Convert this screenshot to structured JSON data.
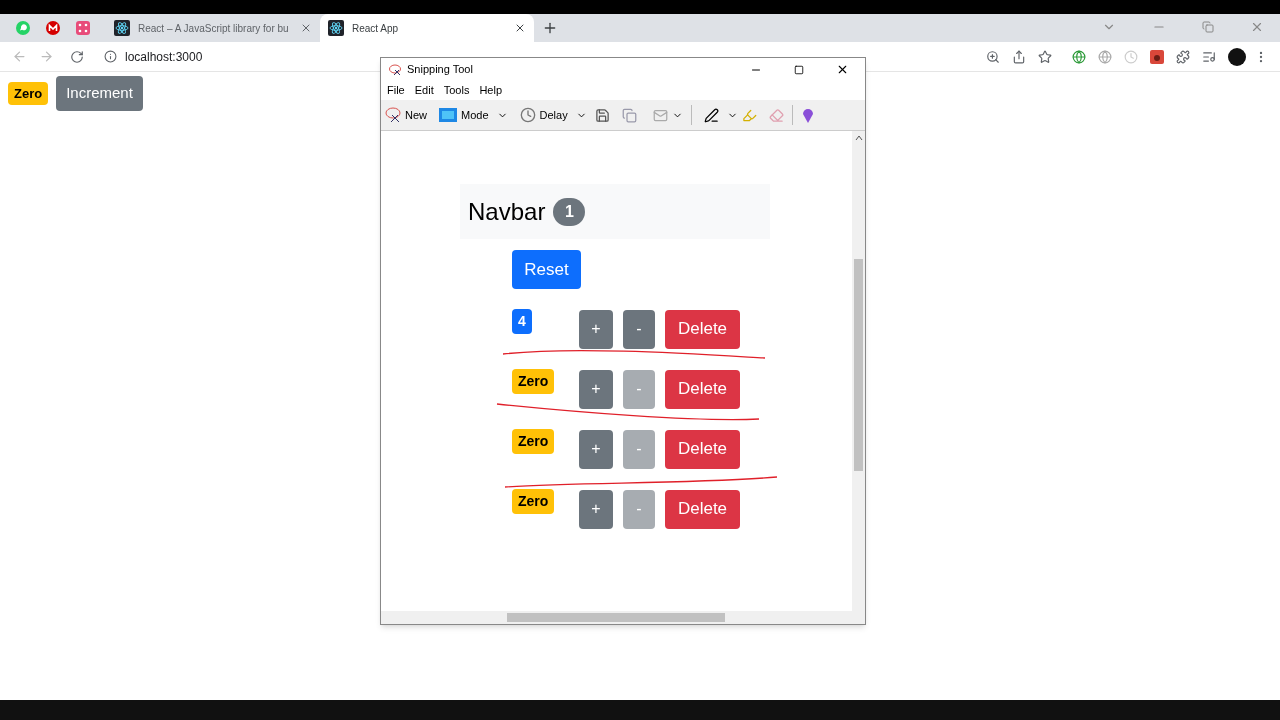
{
  "browser": {
    "tabs": [
      {
        "title": "React – A JavaScript library for bu",
        "selected": false
      },
      {
        "title": "React App",
        "selected": true
      }
    ],
    "address": "localhost:3000"
  },
  "page": {
    "badge": "Zero",
    "button": "Increment"
  },
  "snipping_tool": {
    "title": "Snipping Tool",
    "menu": [
      "File",
      "Edit",
      "Tools",
      "Help"
    ],
    "toolbar": [
      "New",
      "Mode",
      "Delay"
    ],
    "canvas": {
      "navbar": {
        "title": "Navbar",
        "count": "1"
      },
      "reset": "Reset",
      "rows": [
        {
          "value": "4",
          "color": "#0d6efd",
          "plus": "+",
          "minus": "-",
          "minus_disabled": false,
          "delete": "Delete"
        },
        {
          "value": "Zero",
          "color": "#ffc107",
          "plus": "+",
          "minus": "-",
          "minus_disabled": true,
          "delete": "Delete"
        },
        {
          "value": "Zero",
          "color": "#ffc107",
          "plus": "+",
          "minus": "-",
          "minus_disabled": true,
          "delete": "Delete"
        },
        {
          "value": "Zero",
          "color": "#ffc107",
          "plus": "+",
          "minus": "-",
          "minus_disabled": true,
          "delete": "Delete"
        }
      ]
    }
  }
}
